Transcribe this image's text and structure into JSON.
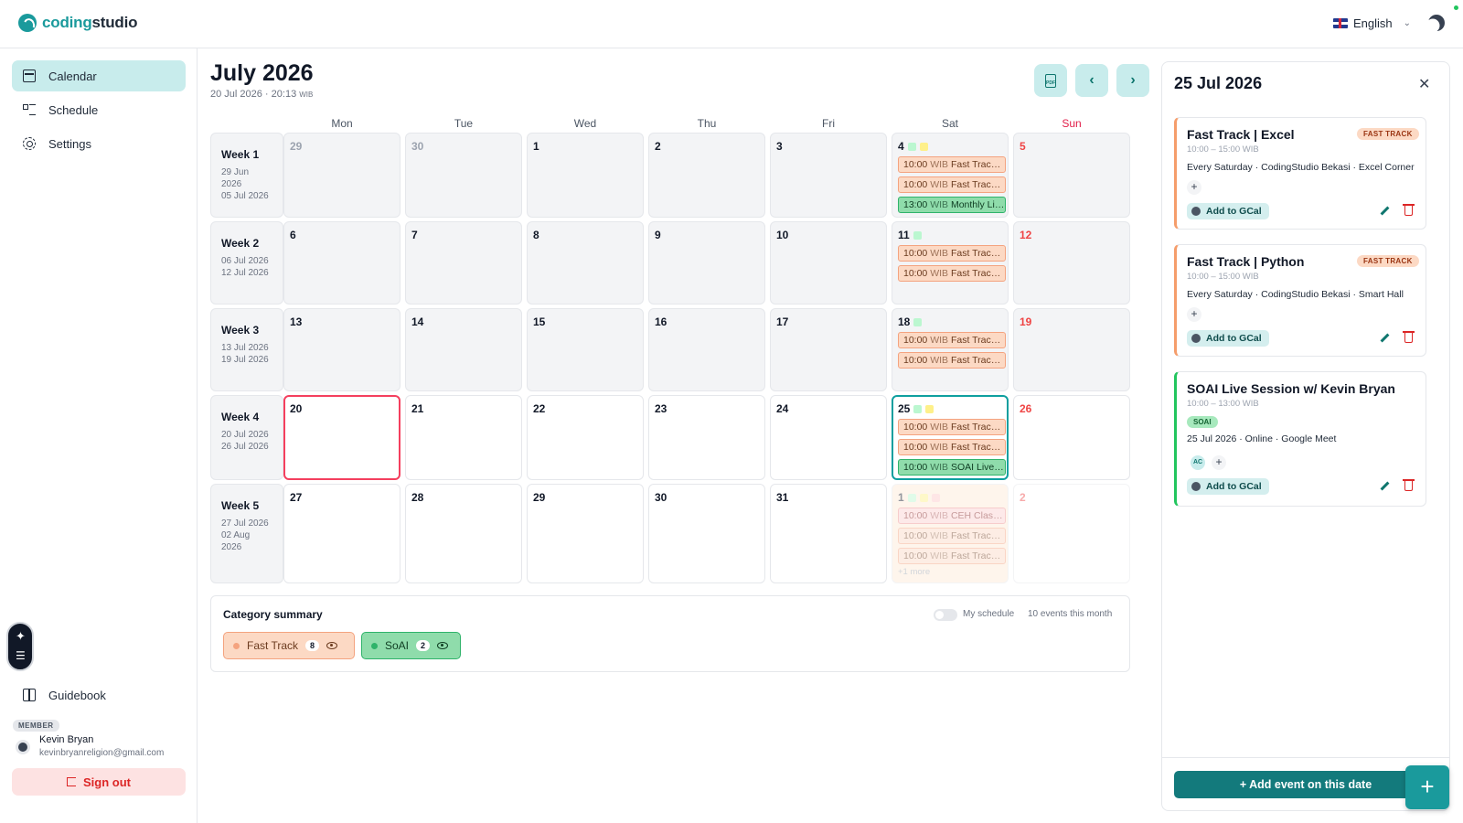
{
  "app": {
    "logo_a": "coding",
    "logo_b": "studio",
    "language": "English"
  },
  "sidebar": {
    "items": [
      {
        "label": "Calendar",
        "icon": "calendar-icon",
        "active": true
      },
      {
        "label": "Schedule",
        "icon": "list-icon"
      },
      {
        "label": "Settings",
        "icon": "gear-icon"
      }
    ],
    "guidebook": "Guidebook",
    "member_badge": "MEMBER",
    "user_name": "Kevin Bryan",
    "user_email": "kevinbryanreligion@gmail.com",
    "signout": "Sign out"
  },
  "main": {
    "title": "July 2026",
    "subtitle": "20 Jul 2026 · 20:13",
    "subtitle_tz": "WIB",
    "days_of_week": [
      "Mon",
      "Tue",
      "Wed",
      "Thu",
      "Fri",
      "Sat",
      "Sun"
    ],
    "weeks": [
      {
        "label": "Week 1",
        "range": [
          "29 Jun",
          "2026",
          "05 Jul 2026"
        ]
      },
      {
        "label": "Week 2",
        "range": [
          "06 Jul 2026",
          "12 Jul 2026"
        ]
      },
      {
        "label": "Week 3",
        "range": [
          "13 Jul 2026",
          "19 Jul 2026"
        ]
      },
      {
        "label": "Week 4",
        "range": [
          "20 Jul 2026",
          "26 Jul 2026"
        ]
      },
      {
        "label": "Week 5",
        "range": [
          "27 Jul 2026",
          "02 Aug",
          "2026"
        ]
      }
    ],
    "days": [
      [
        "29",
        "30",
        "1",
        "2",
        "3",
        "4",
        "5"
      ],
      [
        "6",
        "7",
        "8",
        "9",
        "10",
        "11",
        "12"
      ],
      [
        "13",
        "14",
        "15",
        "16",
        "17",
        "18",
        "19"
      ],
      [
        "20",
        "21",
        "22",
        "23",
        "24",
        "25",
        "26"
      ],
      [
        "27",
        "28",
        "29",
        "30",
        "31",
        "1",
        "2"
      ]
    ],
    "events": {
      "w0": [
        {
          "time": "10:00",
          "tz": "WIB",
          "name": "Fast Track ...",
          "cat": "o"
        },
        {
          "time": "10:00",
          "tz": "WIB",
          "name": "Fast Track ...",
          "cat": "o"
        },
        {
          "time": "13:00",
          "tz": "WIB",
          "name": "Monthly Liv...",
          "cat": "gr"
        }
      ],
      "w1": [
        {
          "time": "10:00",
          "tz": "WIB",
          "name": "Fast Track ...",
          "cat": "o"
        },
        {
          "time": "10:00",
          "tz": "WIB",
          "name": "Fast Track ...",
          "cat": "o"
        }
      ],
      "w2": [
        {
          "time": "10:00",
          "tz": "WIB",
          "name": "Fast Track ...",
          "cat": "o"
        },
        {
          "time": "10:00",
          "tz": "WIB",
          "name": "Fast Track ...",
          "cat": "o"
        }
      ],
      "w3": [
        {
          "time": "10:00",
          "tz": "WIB",
          "name": "Fast Track ...",
          "cat": "o"
        },
        {
          "time": "10:00",
          "tz": "WIB",
          "name": "Fast Track ...",
          "cat": "o"
        },
        {
          "time": "10:00",
          "tz": "WIB",
          "name": "SOAI Live S...",
          "cat": "gr"
        }
      ],
      "w4": [
        {
          "time": "10:00",
          "tz": "WIB",
          "name": "CEH Class ...",
          "cat": "pk"
        },
        {
          "time": "10:00",
          "tz": "WIB",
          "name": "Fast Track ...",
          "cat": "o"
        },
        {
          "time": "10:00",
          "tz": "WIB",
          "name": "Fast Track ...",
          "cat": "o"
        }
      ],
      "more": "+1 more"
    },
    "category_summary": {
      "title": "Category summary",
      "my_schedule": "My schedule",
      "event_count": "10 events this month",
      "chips": [
        {
          "label": "Fast Track",
          "count": "8"
        },
        {
          "label": "SoAI",
          "count": "2"
        }
      ]
    }
  },
  "panel": {
    "title": "25 Jul 2026",
    "cards": [
      {
        "title": "Fast Track | Excel",
        "time": "10:00 – 15:00 WIB",
        "tag": "FAST TRACK",
        "desc": "Every Saturday · CodingStudio Bekasi · Excel Corner",
        "gcal": "Add to GCal"
      },
      {
        "title": "Fast Track | Python",
        "time": "10:00 – 15:00 WIB",
        "tag": "FAST TRACK",
        "desc": "Every Saturday · CodingStudio Bekasi · Smart Hall",
        "gcal": "Add to GCal"
      },
      {
        "title": "SOAI Live Session w/ Kevin Bryan",
        "time": "10:00 – 13:00 WIB",
        "tag": "SOAI",
        "desc": "25 Jul 2026 · Online · Google Meet",
        "avatar": "AC",
        "gcal": "Add to GCal"
      }
    ],
    "add_button": "+ Add event on this date"
  },
  "colors": {
    "accent": "#1a9a9c",
    "fast_track": "#fcd9c4",
    "soai": "#8fdcab",
    "danger": "#dc2626"
  }
}
